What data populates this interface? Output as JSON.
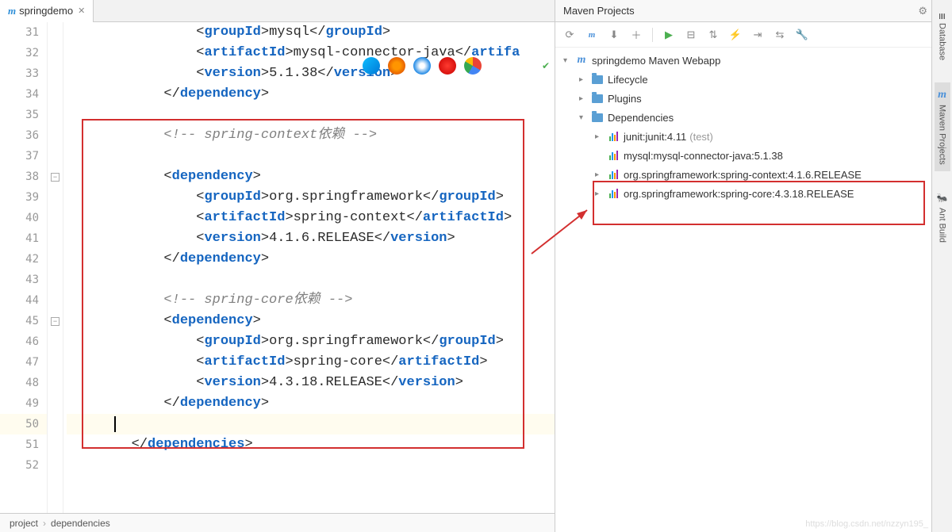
{
  "tab": {
    "icon_name": "maven-m-icon",
    "label": "springdemo"
  },
  "gutter_lines": [
    "31",
    "32",
    "33",
    "34",
    "35",
    "36",
    "37",
    "38",
    "39",
    "40",
    "41",
    "42",
    "43",
    "44",
    "45",
    "46",
    "47",
    "48",
    "49",
    "50",
    "51",
    "52"
  ],
  "current_line": "50",
  "code": {
    "lines": [
      {
        "indent": 16,
        "tokens": [
          [
            "<",
            "b"
          ],
          [
            "groupId",
            "t"
          ],
          [
            ">",
            "b"
          ],
          [
            "mysql",
            "x"
          ],
          [
            "</",
            "b"
          ],
          [
            "groupId",
            "t"
          ],
          [
            ">",
            "b"
          ]
        ]
      },
      {
        "indent": 16,
        "tokens": [
          [
            "<",
            "b"
          ],
          [
            "artifactId",
            "t"
          ],
          [
            ">",
            "b"
          ],
          [
            "mysql-connector-java",
            "x"
          ],
          [
            "</",
            "b"
          ],
          [
            "artifa",
            "t"
          ]
        ]
      },
      {
        "indent": 16,
        "tokens": [
          [
            "<",
            "b"
          ],
          [
            "version",
            "t"
          ],
          [
            ">",
            "b"
          ],
          [
            "5.1.38",
            "x"
          ],
          [
            "</",
            "b"
          ],
          [
            "version",
            "t"
          ],
          [
            ">",
            "b"
          ]
        ]
      },
      {
        "indent": 12,
        "tokens": [
          [
            "</",
            "b"
          ],
          [
            "dependency",
            "t"
          ],
          [
            ">",
            "b"
          ]
        ]
      },
      {
        "indent": 0,
        "tokens": []
      },
      {
        "indent": 12,
        "tokens": [
          [
            "<!-- spring-context依赖 -->",
            "c"
          ]
        ]
      },
      {
        "indent": 0,
        "tokens": []
      },
      {
        "indent": 12,
        "tokens": [
          [
            "<",
            "b"
          ],
          [
            "dependency",
            "t"
          ],
          [
            ">",
            "b"
          ]
        ]
      },
      {
        "indent": 16,
        "tokens": [
          [
            "<",
            "b"
          ],
          [
            "groupId",
            "t"
          ],
          [
            ">",
            "b"
          ],
          [
            "org.springframework",
            "x"
          ],
          [
            "</",
            "b"
          ],
          [
            "groupId",
            "t"
          ],
          [
            ">",
            "b"
          ]
        ]
      },
      {
        "indent": 16,
        "tokens": [
          [
            "<",
            "b"
          ],
          [
            "artifactId",
            "t"
          ],
          [
            ">",
            "b"
          ],
          [
            "spring-context",
            "x"
          ],
          [
            "</",
            "b"
          ],
          [
            "artifactId",
            "t"
          ],
          [
            ">",
            "b"
          ]
        ]
      },
      {
        "indent": 16,
        "tokens": [
          [
            "<",
            "b"
          ],
          [
            "version",
            "t"
          ],
          [
            ">",
            "b"
          ],
          [
            "4.1.6.RELEASE",
            "x"
          ],
          [
            "</",
            "b"
          ],
          [
            "version",
            "t"
          ],
          [
            ">",
            "b"
          ]
        ]
      },
      {
        "indent": 12,
        "tokens": [
          [
            "</",
            "b"
          ],
          [
            "dependency",
            "t"
          ],
          [
            ">",
            "b"
          ]
        ]
      },
      {
        "indent": 0,
        "tokens": []
      },
      {
        "indent": 12,
        "tokens": [
          [
            "<!-- spring-core依赖 -->",
            "c"
          ]
        ]
      },
      {
        "indent": 12,
        "tokens": [
          [
            "<",
            "b"
          ],
          [
            "dependency",
            "t"
          ],
          [
            ">",
            "b"
          ]
        ]
      },
      {
        "indent": 16,
        "tokens": [
          [
            "<",
            "b"
          ],
          [
            "groupId",
            "t"
          ],
          [
            ">",
            "b"
          ],
          [
            "org.springframework",
            "x"
          ],
          [
            "</",
            "b"
          ],
          [
            "groupId",
            "t"
          ],
          [
            ">",
            "b"
          ]
        ]
      },
      {
        "indent": 16,
        "tokens": [
          [
            "<",
            "b"
          ],
          [
            "artifactId",
            "t"
          ],
          [
            ">",
            "b"
          ],
          [
            "spring-core",
            "x"
          ],
          [
            "</",
            "b"
          ],
          [
            "artifactId",
            "t"
          ],
          [
            ">",
            "b"
          ]
        ]
      },
      {
        "indent": 16,
        "tokens": [
          [
            "<",
            "b"
          ],
          [
            "version",
            "t"
          ],
          [
            ">",
            "b"
          ],
          [
            "4.3.18.RELEASE",
            "x"
          ],
          [
            "</",
            "b"
          ],
          [
            "version",
            "t"
          ],
          [
            ">",
            "b"
          ]
        ]
      },
      {
        "indent": 12,
        "tokens": [
          [
            "</",
            "b"
          ],
          [
            "dependency",
            "t"
          ],
          [
            ">",
            "b"
          ]
        ]
      },
      {
        "indent": 12,
        "tokens": []
      },
      {
        "indent": 8,
        "tokens": [
          [
            "</",
            "b"
          ],
          [
            "dependencies",
            "t"
          ],
          [
            ">",
            "b"
          ]
        ]
      },
      {
        "indent": 0,
        "tokens": []
      }
    ]
  },
  "breadcrumb": {
    "parts": [
      "project",
      "dependencies"
    ]
  },
  "maven": {
    "title": "Maven Projects",
    "root": "springdemo Maven Webapp",
    "nodes": {
      "lifecycle": "Lifecycle",
      "plugins": "Plugins",
      "dependencies": "Dependencies",
      "junit": "junit:junit:4.11",
      "junit_scope": "(test)",
      "mysql": "mysql:mysql-connector-java:5.1.38",
      "spring_context": "org.springframework:spring-context:4.1.6.RELEASE",
      "spring_core": "org.springframework:spring-core:4.3.18.RELEASE"
    }
  },
  "sidebar": {
    "database": "Database",
    "maven_projects": "Maven Projects",
    "ant_build": "Ant Build"
  },
  "watermark": "https://blog.csdn.net/nzzyn195_"
}
